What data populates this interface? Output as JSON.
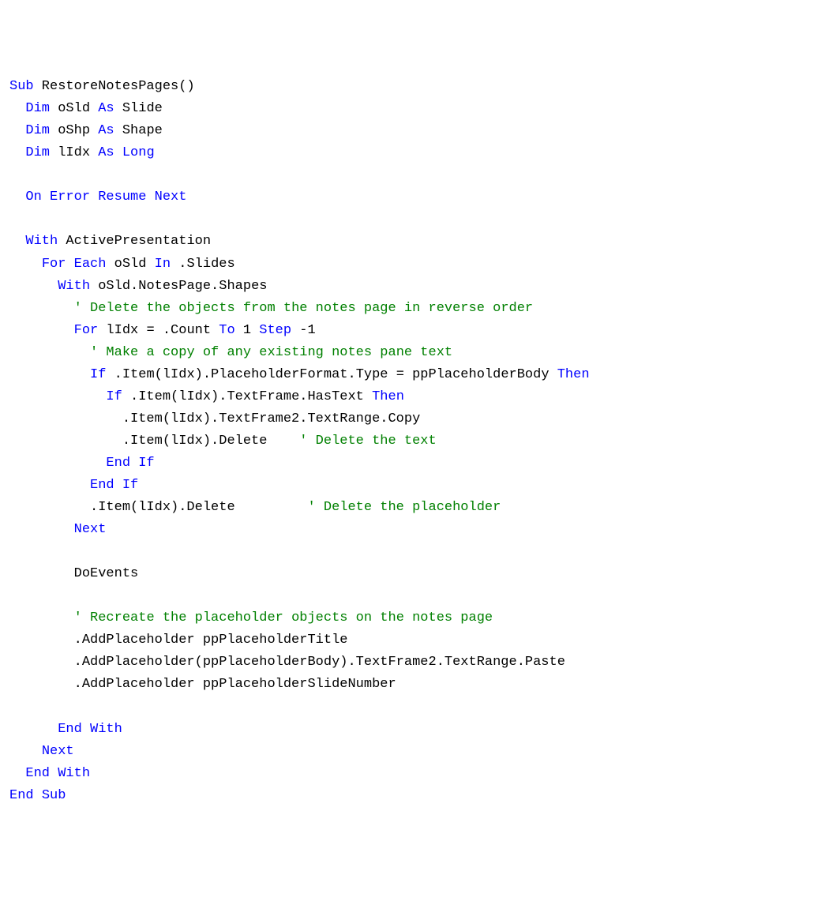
{
  "code": {
    "tokens": [
      [
        {
          "t": "Sub",
          "c": "kw"
        },
        {
          "t": " RestoreNotesPages()",
          "c": "blk"
        }
      ],
      [
        {
          "t": "  ",
          "c": "blk"
        },
        {
          "t": "Dim",
          "c": "kw"
        },
        {
          "t": " oSld ",
          "c": "blk"
        },
        {
          "t": "As",
          "c": "kw"
        },
        {
          "t": " Slide",
          "c": "blk"
        }
      ],
      [
        {
          "t": "  ",
          "c": "blk"
        },
        {
          "t": "Dim",
          "c": "kw"
        },
        {
          "t": " oShp ",
          "c": "blk"
        },
        {
          "t": "As",
          "c": "kw"
        },
        {
          "t": " Shape",
          "c": "blk"
        }
      ],
      [
        {
          "t": "  ",
          "c": "blk"
        },
        {
          "t": "Dim",
          "c": "kw"
        },
        {
          "t": " lIdx ",
          "c": "blk"
        },
        {
          "t": "As",
          "c": "kw"
        },
        {
          "t": " ",
          "c": "blk"
        },
        {
          "t": "Long",
          "c": "kw"
        }
      ],
      [],
      [
        {
          "t": "  ",
          "c": "blk"
        },
        {
          "t": "On",
          "c": "kw"
        },
        {
          "t": " ",
          "c": "blk"
        },
        {
          "t": "Error",
          "c": "kw"
        },
        {
          "t": " ",
          "c": "blk"
        },
        {
          "t": "Resume",
          "c": "kw"
        },
        {
          "t": " ",
          "c": "blk"
        },
        {
          "t": "Next",
          "c": "kw"
        }
      ],
      [],
      [
        {
          "t": "  ",
          "c": "blk"
        },
        {
          "t": "With",
          "c": "kw"
        },
        {
          "t": " ActivePresentation",
          "c": "blk"
        }
      ],
      [
        {
          "t": "    ",
          "c": "blk"
        },
        {
          "t": "For",
          "c": "kw"
        },
        {
          "t": " ",
          "c": "blk"
        },
        {
          "t": "Each",
          "c": "kw"
        },
        {
          "t": " oSld ",
          "c": "blk"
        },
        {
          "t": "In",
          "c": "kw"
        },
        {
          "t": " .Slides",
          "c": "blk"
        }
      ],
      [
        {
          "t": "      ",
          "c": "blk"
        },
        {
          "t": "With",
          "c": "kw"
        },
        {
          "t": " oSld.NotesPage.Shapes",
          "c": "blk"
        }
      ],
      [
        {
          "t": "        ",
          "c": "blk"
        },
        {
          "t": "' Delete the objects from the notes page in reverse order",
          "c": "cm"
        }
      ],
      [
        {
          "t": "        ",
          "c": "blk"
        },
        {
          "t": "For",
          "c": "kw"
        },
        {
          "t": " lIdx = .Count ",
          "c": "blk"
        },
        {
          "t": "To",
          "c": "kw"
        },
        {
          "t": " 1 ",
          "c": "blk"
        },
        {
          "t": "Step",
          "c": "kw"
        },
        {
          "t": " -1",
          "c": "blk"
        }
      ],
      [
        {
          "t": "          ",
          "c": "blk"
        },
        {
          "t": "' Make a copy of any existing notes pane text",
          "c": "cm"
        }
      ],
      [
        {
          "t": "          ",
          "c": "blk"
        },
        {
          "t": "If",
          "c": "kw"
        },
        {
          "t": " .Item(lIdx).PlaceholderFormat.Type = ppPlaceholderBody ",
          "c": "blk"
        },
        {
          "t": "Then",
          "c": "kw"
        }
      ],
      [
        {
          "t": "            ",
          "c": "blk"
        },
        {
          "t": "If",
          "c": "kw"
        },
        {
          "t": " .Item(lIdx).TextFrame.HasText ",
          "c": "blk"
        },
        {
          "t": "Then",
          "c": "kw"
        }
      ],
      [
        {
          "t": "              .Item(lIdx).TextFrame2.TextRange.Copy",
          "c": "blk"
        }
      ],
      [
        {
          "t": "              .Item(lIdx).Delete    ",
          "c": "blk"
        },
        {
          "t": "' Delete the text",
          "c": "cm"
        }
      ],
      [
        {
          "t": "            ",
          "c": "blk"
        },
        {
          "t": "End",
          "c": "kw"
        },
        {
          "t": " ",
          "c": "blk"
        },
        {
          "t": "If",
          "c": "kw"
        }
      ],
      [
        {
          "t": "          ",
          "c": "blk"
        },
        {
          "t": "End",
          "c": "kw"
        },
        {
          "t": " ",
          "c": "blk"
        },
        {
          "t": "If",
          "c": "kw"
        }
      ],
      [
        {
          "t": "          .Item(lIdx).Delete         ",
          "c": "blk"
        },
        {
          "t": "' Delete the placeholder",
          "c": "cm"
        }
      ],
      [
        {
          "t": "        ",
          "c": "blk"
        },
        {
          "t": "Next",
          "c": "kw"
        }
      ],
      [],
      [
        {
          "t": "        DoEvents",
          "c": "blk"
        }
      ],
      [],
      [
        {
          "t": "        ",
          "c": "blk"
        },
        {
          "t": "' Recreate the placeholder objects on the notes page",
          "c": "cm"
        }
      ],
      [
        {
          "t": "        .AddPlaceholder ppPlaceholderTitle",
          "c": "blk"
        }
      ],
      [
        {
          "t": "        .AddPlaceholder(ppPlaceholderBody).TextFrame2.TextRange.Paste",
          "c": "blk"
        }
      ],
      [
        {
          "t": "        .AddPlaceholder ppPlaceholderSlideNumber",
          "c": "blk"
        }
      ],
      [],
      [
        {
          "t": "      ",
          "c": "blk"
        },
        {
          "t": "End",
          "c": "kw"
        },
        {
          "t": " ",
          "c": "blk"
        },
        {
          "t": "With",
          "c": "kw"
        }
      ],
      [
        {
          "t": "    ",
          "c": "blk"
        },
        {
          "t": "Next",
          "c": "kw"
        }
      ],
      [
        {
          "t": "  ",
          "c": "blk"
        },
        {
          "t": "End",
          "c": "kw"
        },
        {
          "t": " ",
          "c": "blk"
        },
        {
          "t": "With",
          "c": "kw"
        }
      ],
      [
        {
          "t": "End",
          "c": "kw"
        },
        {
          "t": " ",
          "c": "blk"
        },
        {
          "t": "Sub",
          "c": "kw"
        }
      ]
    ]
  }
}
